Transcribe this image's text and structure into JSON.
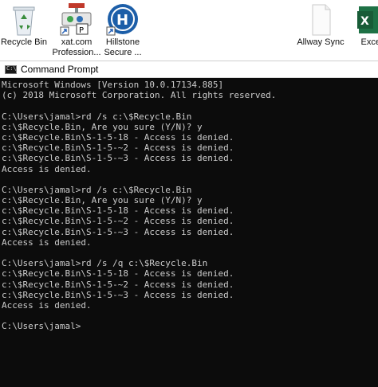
{
  "desktop": {
    "icons": [
      {
        "label": "Recycle Bin",
        "icon": "recycle-bin-icon"
      },
      {
        "label": "xat.com\nProfession...",
        "icon": "xat-app-icon"
      },
      {
        "label": "Hillstone\nSecure ...",
        "icon": "hillstone-icon"
      },
      {
        "label": "Allway Sync",
        "icon": "document-icon"
      },
      {
        "label": "Excel",
        "icon": "excel-icon"
      }
    ]
  },
  "window": {
    "title": "Command Prompt",
    "lines": [
      "Microsoft Windows [Version 10.0.17134.885]",
      "(c) 2018 Microsoft Corporation. All rights reserved.",
      "",
      "C:\\Users\\jamal>rd /s c:\\$Recycle.Bin",
      "c:\\$Recycle.Bin, Are you sure (Y/N)? y",
      "c:\\$Recycle.Bin\\S-1-5-18 - Access is denied.",
      "c:\\$Recycle.Bin\\S-1-5-~2 - Access is denied.",
      "c:\\$Recycle.Bin\\S-1-5-~3 - Access is denied.",
      "Access is denied.",
      "",
      "C:\\Users\\jamal>rd /s c:\\$Recycle.Bin",
      "c:\\$Recycle.Bin, Are you sure (Y/N)? y",
      "c:\\$Recycle.Bin\\S-1-5-18 - Access is denied.",
      "c:\\$Recycle.Bin\\S-1-5-~2 - Access is denied.",
      "c:\\$Recycle.Bin\\S-1-5-~3 - Access is denied.",
      "Access is denied.",
      "",
      "C:\\Users\\jamal>rd /s /q c:\\$Recycle.Bin",
      "c:\\$Recycle.Bin\\S-1-5-18 - Access is denied.",
      "c:\\$Recycle.Bin\\S-1-5-~2 - Access is denied.",
      "c:\\$Recycle.Bin\\S-1-5-~3 - Access is denied.",
      "Access is denied.",
      "",
      "C:\\Users\\jamal>"
    ]
  }
}
